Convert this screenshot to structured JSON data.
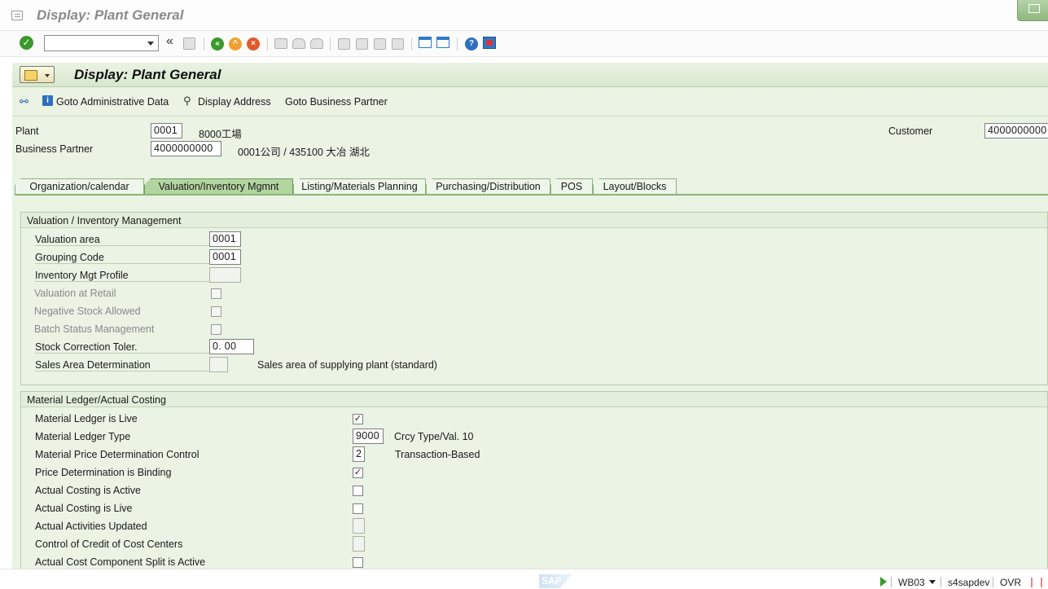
{
  "window": {
    "title": "Display: Plant General"
  },
  "toolbar": {
    "command_field": "",
    "icons": [
      "enter-icon",
      "command-dropdown-icon",
      "collapse-icon",
      "save-icon",
      "back-icon",
      "exit-icon",
      "cancel-icon",
      "print-icon",
      "find-icon",
      "find-next-icon",
      "first-page-icon",
      "previous-page-icon",
      "next-page-icon",
      "last-page-icon",
      "create-session-icon",
      "create-shortcut-icon",
      "help-icon",
      "customize-layout-icon"
    ]
  },
  "header": {
    "title": "Display: Plant General"
  },
  "app_toolbar": {
    "goto_admin": "Goto Administrative Data",
    "display_address": "Display Address",
    "goto_bp": "Goto Business Partner"
  },
  "fields": {
    "plant": {
      "label": "Plant",
      "value": "0001",
      "desc": "8000工場"
    },
    "business_partner": {
      "label": "Business Partner",
      "value": "4000000000",
      "desc": "0001公司 / 435100 大冶 湖北"
    },
    "customer": {
      "label": "Customer",
      "value": "4000000000"
    }
  },
  "tabs": [
    {
      "label": "Organization/calendar",
      "active": false
    },
    {
      "label": "Valuation/Inventory Mgmnt",
      "active": true
    },
    {
      "label": "Listing/Materials Planning",
      "active": false
    },
    {
      "label": "Purchasing/Distribution",
      "active": false
    },
    {
      "label": "POS",
      "active": false
    },
    {
      "label": "Layout/Blocks",
      "active": false
    }
  ],
  "valuation_group": {
    "title": "Valuation / Inventory Management",
    "valuation_area": {
      "label": "Valuation area",
      "value": "0001"
    },
    "grouping_code": {
      "label": "Grouping Code",
      "value": "0001"
    },
    "inv_mgt_profile": {
      "label": "Inventory Mgt Profile",
      "value": ""
    },
    "valuation_at_retail": {
      "label": "Valuation at Retail",
      "checked": false
    },
    "negative_stock": {
      "label": "Negative Stock Allowed",
      "checked": false
    },
    "batch_status": {
      "label": "Batch Status Management",
      "checked": false
    },
    "stock_correction": {
      "label": "Stock Correction Toler.",
      "value": "0. 00"
    },
    "sales_area_det": {
      "label": "Sales Area Determination",
      "value": "",
      "desc": "Sales area of supplying plant (standard)"
    }
  },
  "ml_group": {
    "title": "Material Ledger/Actual Costing",
    "ml_live": {
      "label": "Material Ledger is Live",
      "checked": true
    },
    "ml_type": {
      "label": "Material Ledger Type",
      "value": "9000",
      "desc": "Crcy Type/Val. 10"
    },
    "price_det": {
      "label": "Material Price Determination Control",
      "value": "2",
      "desc": "Transaction-Based"
    },
    "price_binding": {
      "label": "Price Determination is Binding",
      "checked": true
    },
    "ac_active": {
      "label": "Actual Costing is Active",
      "checked": false
    },
    "ac_live": {
      "label": "Actual Costing is Live",
      "checked": false
    },
    "activities_updated": {
      "label": "Actual Activities Updated",
      "value": ""
    },
    "credit_control": {
      "label": "Control of Credit of Cost Centers",
      "value": ""
    },
    "cost_split": {
      "label": "Actual Cost Component Split is Active",
      "checked": false
    }
  },
  "status": {
    "transaction": "WB03",
    "server": "s4sapdev",
    "mode": "OVR",
    "logo": "SAP"
  },
  "colors": {
    "panel_bg": "#eaf3e4",
    "tab_active": "#b3d5a0",
    "accent_green": "#3b9a2c"
  }
}
